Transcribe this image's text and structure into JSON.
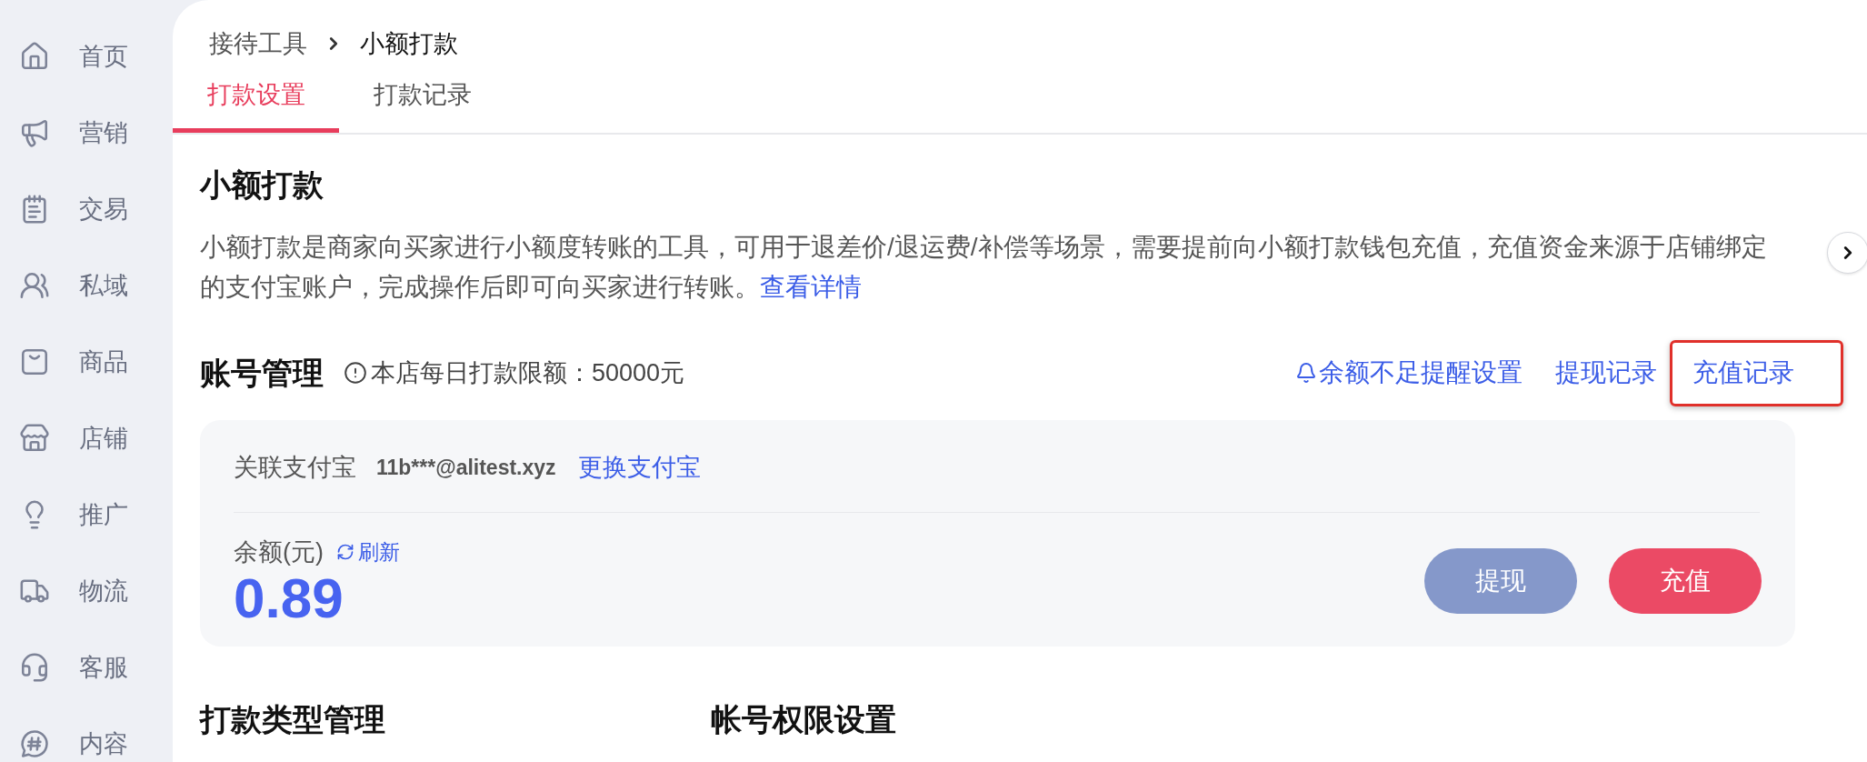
{
  "sidebar": {
    "items": [
      {
        "label": "首页"
      },
      {
        "label": "营销"
      },
      {
        "label": "交易"
      },
      {
        "label": "私域"
      },
      {
        "label": "商品"
      },
      {
        "label": "店铺"
      },
      {
        "label": "推广"
      },
      {
        "label": "物流"
      },
      {
        "label": "客服"
      },
      {
        "label": "内容"
      }
    ]
  },
  "breadcrumb": [
    {
      "label": "接待工具",
      "current": false
    },
    {
      "label": "小额打款",
      "current": true
    }
  ],
  "tabs": [
    {
      "label": "打款设置",
      "selected": true
    },
    {
      "label": "打款记录",
      "selected": false
    }
  ],
  "intro": {
    "title": "小额打款",
    "description": "小额打款是商家向买家进行小额度转账的工具，可用于退差价/退运费/补偿等场景，需要提前向小额打款钱包充值，充值资金来源于店铺绑定的支付宝账户，完成操作后即可向买家进行转账。",
    "link": "查看详情"
  },
  "account": {
    "title": "账号管理",
    "limit_note": "本店每日打款限额：50000元",
    "links": [
      {
        "label": "余额不足提醒设置",
        "kind": "alert",
        "highlighted": false
      },
      {
        "label": "提现记录",
        "kind": "plain",
        "highlighted": false
      },
      {
        "label": "充值记录",
        "kind": "plain",
        "highlighted": true
      }
    ]
  },
  "card": {
    "alipay_label": "关联支付宝",
    "alipay_account": "11b***@alitest.xyz",
    "change_link": "更换支付宝",
    "balance_label": "余额(元)",
    "refresh": "刷新",
    "balance": "0.89",
    "buttons": [
      {
        "label": "提现",
        "kind": "secondary"
      },
      {
        "label": "充值",
        "kind": "primary"
      }
    ]
  },
  "sections": [
    {
      "title": "打款类型管理"
    },
    {
      "title": "帐号权限设置"
    }
  ]
}
